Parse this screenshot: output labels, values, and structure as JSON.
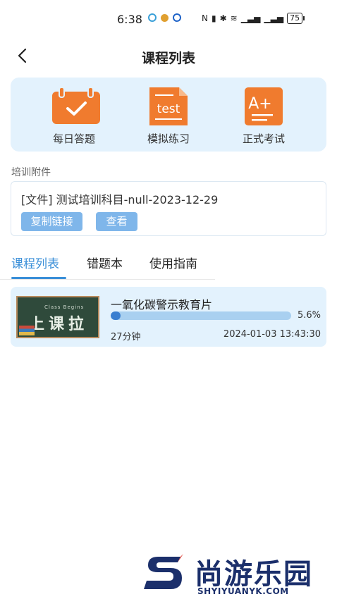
{
  "status_bar": {
    "time": "6:38",
    "battery": "75"
  },
  "nav": {
    "title": "课程列表"
  },
  "modes": [
    {
      "label": "每日答题",
      "icon": "check-calendar-icon",
      "color": "#f07b2e"
    },
    {
      "label": "模拟练习",
      "icon": "test-document-icon",
      "color": "#f07b2e",
      "icon_text": "test"
    },
    {
      "label": "正式考试",
      "icon": "exam-grade-icon",
      "color": "#f07b2e",
      "icon_text": "A+"
    }
  ],
  "attachments": {
    "section_label": "培训附件",
    "file_text": "[文件] 测试培训科目-null-2023-12-29",
    "copy_link_label": "复制链接",
    "view_label": "查看"
  },
  "tabs": [
    {
      "label": "课程列表",
      "active": true
    },
    {
      "label": "错题本",
      "active": false
    },
    {
      "label": "使用指南",
      "active": false
    }
  ],
  "courses": [
    {
      "title": "一氧化碳警示教育片",
      "progress_text": "5.6%",
      "progress": 0.056,
      "duration": "27分钟",
      "date": "2024-01-03 13:43:30",
      "thumbnail": {
        "small_text": "Class Begins",
        "big_text": "上课拉"
      }
    }
  ],
  "watermark": {
    "text": "尚游乐园",
    "sub": "SHYIYUANYK.COM"
  },
  "colors": {
    "accent": "#3a8fd8",
    "card_bg": "#e3f2fd",
    "icon_orange": "#f07b2e",
    "button_blue": "#7fb6ea"
  }
}
